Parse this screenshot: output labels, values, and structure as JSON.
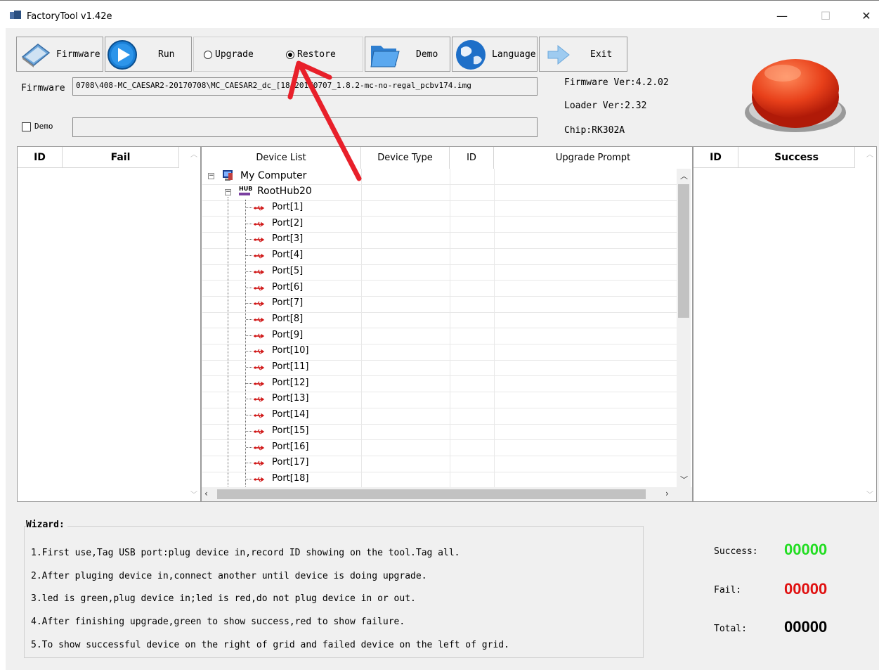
{
  "window": {
    "title": "FactoryTool v1.42e",
    "minimize_glyph": "—",
    "maximize_glyph": "☐",
    "close_glyph": "✕"
  },
  "toolbar": {
    "firmware_label": "Firmware",
    "run_label": "Run",
    "upgrade_label": "Upgrade",
    "restore_label": "Restore",
    "selected_mode": "Restore",
    "demo_label": "Demo",
    "language_label": "Language",
    "exit_label": "Exit"
  },
  "firmware": {
    "label": "Firmware",
    "path": "0708\\408-MC_CAESAR2-20170708\\MC_CAESAR2_dc_[18_20170707_1.8.2-mc-no-regal_pcbv174.img",
    "version": "Firmware Ver:4.2.02",
    "loader": "Loader Ver:2.32",
    "chip": "Chip:RK302A"
  },
  "demo_checkbox": {
    "label": "Demo",
    "checked": false
  },
  "fail_grid": {
    "col_id": "ID",
    "col_status": "Fail"
  },
  "success_grid": {
    "col_id": "ID",
    "col_status": "Success"
  },
  "device_list": {
    "headers": [
      "Device List",
      "Device Type",
      "ID",
      "Upgrade Prompt"
    ],
    "root": "My Computer",
    "hub": "RootHub20",
    "ports": [
      "Port[1]",
      "Port[2]",
      "Port[3]",
      "Port[4]",
      "Port[5]",
      "Port[6]",
      "Port[7]",
      "Port[8]",
      "Port[9]",
      "Port[10]",
      "Port[11]",
      "Port[12]",
      "Port[13]",
      "Port[14]",
      "Port[15]",
      "Port[16]",
      "Port[17]",
      "Port[18]"
    ]
  },
  "wizard": {
    "title": "Wizard:",
    "steps": [
      "1.First use,Tag USB port:plug device in,record ID showing on the tool.Tag all.",
      "2.After pluging device in,connect another until device is doing upgrade.",
      "3.led is green,plug device in;led is red,do not plug device in or out.",
      "4.After finishing upgrade,green to show success,red to show failure.",
      "5.To show successful device on the right of grid and failed device on the left of grid."
    ]
  },
  "counters": {
    "success_label": "Success:",
    "success_value": "00000",
    "fail_label": "Fail:",
    "fail_value": "00000",
    "total_label": "Total:",
    "total_value": "00000"
  },
  "colors": {
    "success": "#22dd22",
    "fail": "#e01010",
    "total": "#000000",
    "annotation_arrow": "#e8202a",
    "big_button": "#e8401a"
  }
}
